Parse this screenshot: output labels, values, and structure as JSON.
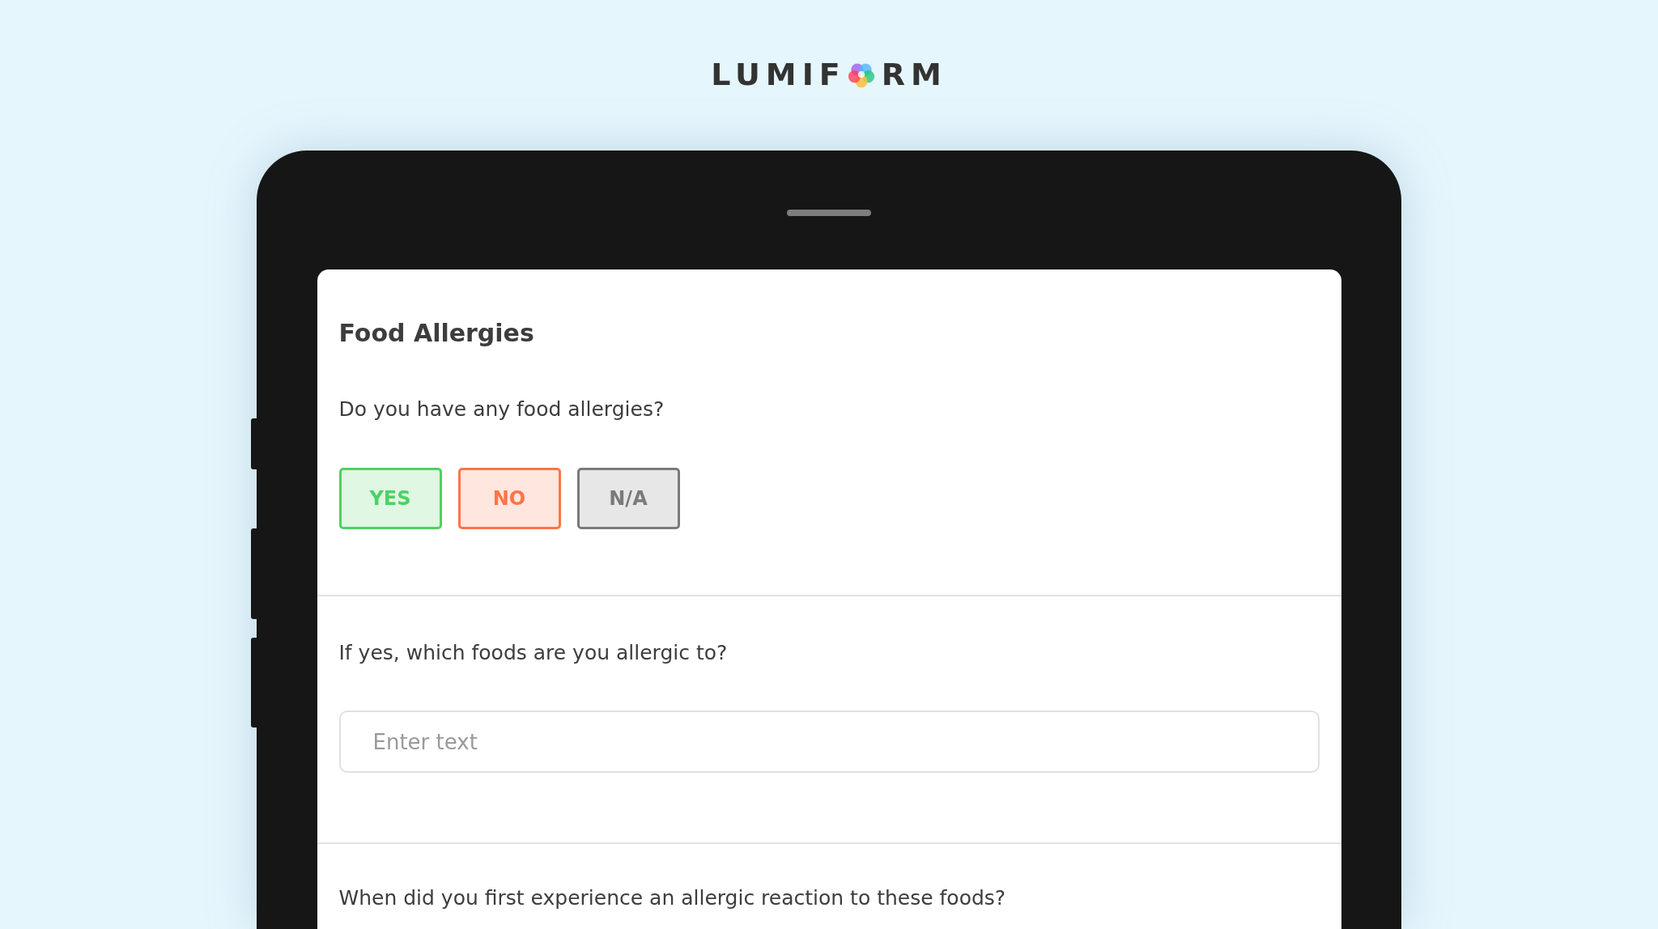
{
  "logo": {
    "before": "LUMIF",
    "after": "RM"
  },
  "form": {
    "title": "Food Allergies",
    "questions": [
      {
        "kind": "choice",
        "text": "Do you have any food allergies?",
        "options": [
          {
            "label": "YES",
            "color": "#4cd263"
          },
          {
            "label": "NO",
            "color": "#ff7448"
          },
          {
            "label": "N/A",
            "color": "#7a7a7a"
          }
        ]
      },
      {
        "kind": "text",
        "text": "If yes, which foods are you allergic to?",
        "placeholder": "Enter text"
      },
      {
        "kind": "heading",
        "text": "When did you first experience an allergic reaction to these foods?"
      }
    ]
  }
}
